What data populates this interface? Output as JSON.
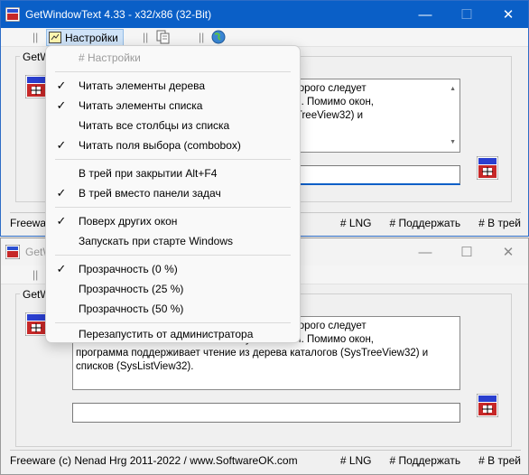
{
  "window": {
    "title": "GetWindowText 4.33 - x32/x86 (32-Bit)",
    "title_inactive": "GetW",
    "minimize_glyph": "—",
    "maximize_glyph": "☐",
    "close_glyph": "✕"
  },
  "toolbar": {
    "settings_label": "Настройки",
    "separator": "||"
  },
  "group": {
    "label": "GetWi"
  },
  "description": {
    "line1": "окно из которого следует",
    "line2": "устите ЛКМ. Помимо окон,",
    "line3": "логов (SysTreeView32) и",
    "full_line3": "программа поддерживает чтение из дерева каталогов (SysTreeView32) и",
    "full_line4": "списков (SysListView32)."
  },
  "status": {
    "freeware": "Freeware (c) Nenad Hrg 2011-2022 / www.SoftwareOK.com",
    "freeware_short": "Freewa",
    "lng": "# LNG",
    "support": "# Поддержать",
    "tray": "# В трей"
  },
  "menu": {
    "items": [
      {
        "label": "# Настройки",
        "checked": "",
        "disabled": true
      },
      {
        "label": "Читать элементы дерева",
        "checked": "✓"
      },
      {
        "label": "Читать элементы списка",
        "checked": "✓"
      },
      {
        "label": "Читать все столбцы из списка",
        "checked": ""
      },
      {
        "label": "Читать поля выбора (combobox)",
        "checked": "✓"
      },
      {
        "label": "В трей при закрытии Alt+F4",
        "checked": ""
      },
      {
        "label": "В трей вместо панели задач",
        "checked": "✓"
      },
      {
        "label": "Поверх других окон",
        "checked": "✓"
      },
      {
        "label": "Запускать при старте Windows",
        "checked": ""
      },
      {
        "label": "Прозрачность (0 %)",
        "checked": "✓"
      },
      {
        "label": "Прозрачность (25 %)",
        "checked": ""
      },
      {
        "label": "Прозрачность (50 %)",
        "checked": ""
      },
      {
        "label": "Перезапустить от администратора",
        "checked": ""
      }
    ]
  },
  "colors": {
    "titlebar_active": "#0a5fc7",
    "menu_bg": "#f9f9f9",
    "highlight": "#cfe3f8"
  },
  "icons": [
    "app-icon",
    "settings-icon",
    "copy-icon",
    "globe-icon",
    "crosshair-drag-icon",
    "checkmark-icon"
  ]
}
